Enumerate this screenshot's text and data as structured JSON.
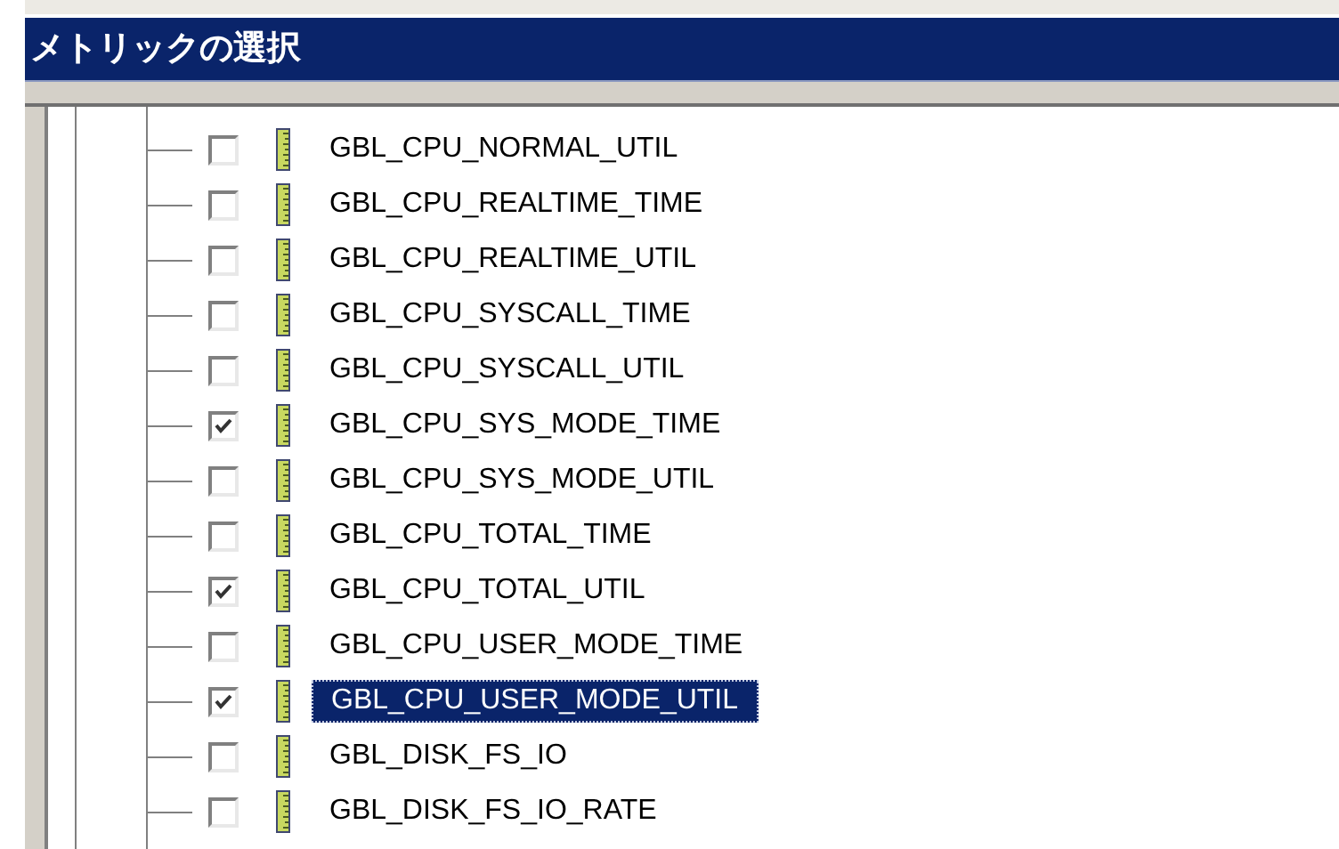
{
  "window": {
    "title": "メトリックの選択"
  },
  "tree": {
    "items": [
      {
        "label": "GBL_CPU_NORMAL_UTIL",
        "checked": false,
        "selected": false
      },
      {
        "label": "GBL_CPU_REALTIME_TIME",
        "checked": false,
        "selected": false
      },
      {
        "label": "GBL_CPU_REALTIME_UTIL",
        "checked": false,
        "selected": false
      },
      {
        "label": "GBL_CPU_SYSCALL_TIME",
        "checked": false,
        "selected": false
      },
      {
        "label": "GBL_CPU_SYSCALL_UTIL",
        "checked": false,
        "selected": false
      },
      {
        "label": "GBL_CPU_SYS_MODE_TIME",
        "checked": true,
        "selected": false
      },
      {
        "label": "GBL_CPU_SYS_MODE_UTIL",
        "checked": false,
        "selected": false
      },
      {
        "label": "GBL_CPU_TOTAL_TIME",
        "checked": false,
        "selected": false
      },
      {
        "label": "GBL_CPU_TOTAL_UTIL",
        "checked": true,
        "selected": false
      },
      {
        "label": "GBL_CPU_USER_MODE_TIME",
        "checked": false,
        "selected": false
      },
      {
        "label": "GBL_CPU_USER_MODE_UTIL",
        "checked": true,
        "selected": true
      },
      {
        "label": "GBL_DISK_FS_IO",
        "checked": false,
        "selected": false
      },
      {
        "label": "GBL_DISK_FS_IO_RATE",
        "checked": false,
        "selected": false
      }
    ]
  }
}
